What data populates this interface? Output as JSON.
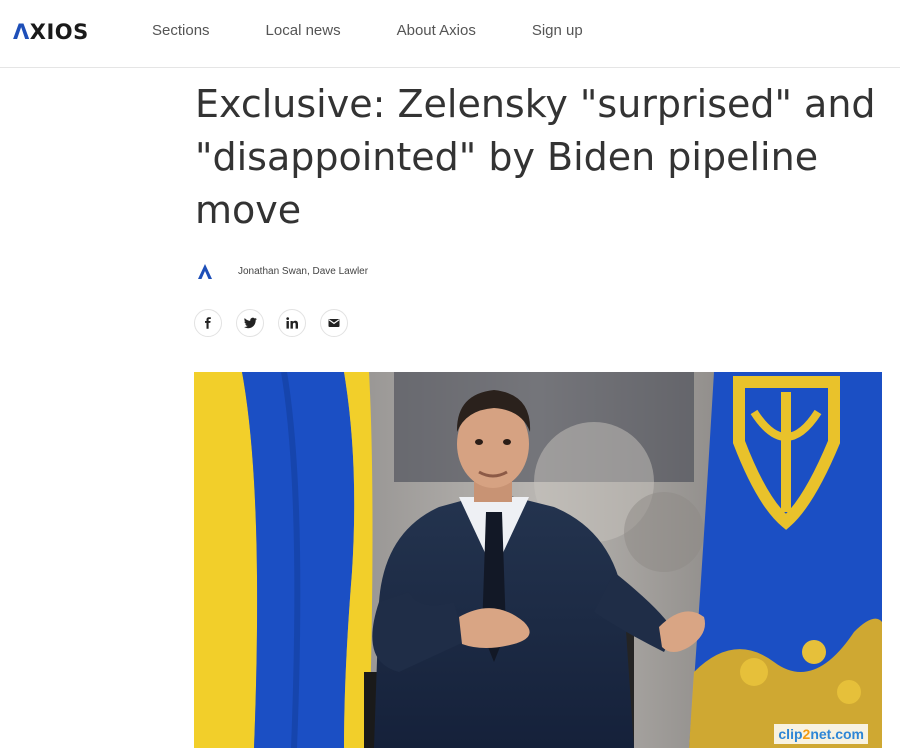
{
  "header": {
    "logo": {
      "text": "AXIOS"
    },
    "nav": [
      {
        "label": "Sections"
      },
      {
        "label": "Local news"
      },
      {
        "label": "About Axios"
      },
      {
        "label": "Sign up"
      }
    ]
  },
  "article": {
    "headline": "Exclusive: Zelensky \"surprised\" and \"disappointed\" by Biden pipeline move",
    "byline": {
      "authors": "Jonathan Swan, Dave Lawler"
    },
    "share": [
      {
        "icon": "facebook-icon"
      },
      {
        "icon": "twitter-icon"
      },
      {
        "icon": "linkedin-icon"
      },
      {
        "icon": "email-icon"
      }
    ],
    "hero_image": {
      "subject": "man in dark suit gesturing in front of Ukrainian flags"
    }
  },
  "watermark": {
    "text_prefix": "clip",
    "text_num": "2",
    "text_suffix": "net.com"
  },
  "colors": {
    "brand_blue": "#1e4fb8",
    "text": "#333333",
    "flag_blue": "#1b4fc4",
    "flag_yellow": "#f2cf2a"
  }
}
